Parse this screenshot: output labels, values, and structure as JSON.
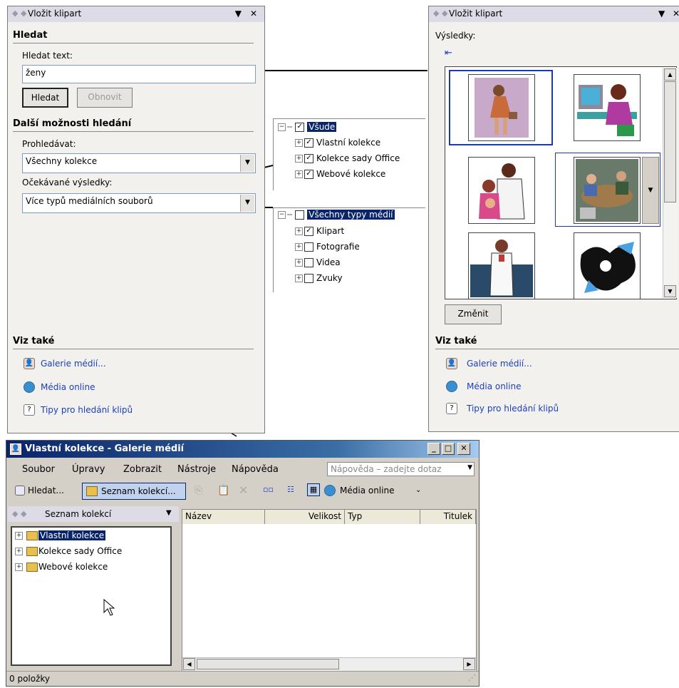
{
  "left_pane": {
    "title": "Vložit klipart",
    "search_heading": "Hledat",
    "search_label": "Hledat text:",
    "search_value": "ženy",
    "search_button": "Hledat",
    "restore_button": "Obnovit",
    "more_heading": "Další možnosti hledání",
    "scope_label": "Prohledávat:",
    "scope_value": "Všechny kolekce",
    "results_label": "Očekávané výsledky:",
    "results_value": "Více typů mediálních souborů",
    "see_also": "Viz také",
    "links": [
      "Galerie médií...",
      "Média online",
      "Tipy pro hledání klipů"
    ]
  },
  "scope_tree": {
    "root": "Všude",
    "children": [
      "Vlastní kolekce",
      "Kolekce sady Office",
      "Webové kolekce"
    ]
  },
  "media_tree": {
    "root": "Všechny typy médií",
    "children": [
      {
        "label": "Klipart",
        "checked": true
      },
      {
        "label": "Fotografie",
        "checked": false
      },
      {
        "label": "Videa",
        "checked": false
      },
      {
        "label": "Zvuky",
        "checked": false
      }
    ]
  },
  "right_pane": {
    "title": "Vložit klipart",
    "results_label": "Výsledky:",
    "modify_button": "Změnit",
    "see_also": "Viz také",
    "links": [
      "Galerie médií...",
      "Média online",
      "Tipy pro hledání klipů"
    ]
  },
  "gallery_window": {
    "title": "Vlastní kolekce - Galerie médií",
    "menu": [
      "Soubor",
      "Úpravy",
      "Zobrazit",
      "Nástroje",
      "Nápověda"
    ],
    "help_placeholder": "Nápověda – zadejte dotaz",
    "toolbar": {
      "search": "Hledat...",
      "collections": "Seznam kolekcí...",
      "online": "Média online"
    },
    "sidebar_title": "Seznam kolekcí",
    "collections": [
      "Vlastní kolekce",
      "Kolekce sady Office",
      "Webové kolekce"
    ],
    "columns": [
      "Název",
      "Velikost",
      "Typ",
      "Titulek"
    ],
    "status": "0 položky"
  }
}
